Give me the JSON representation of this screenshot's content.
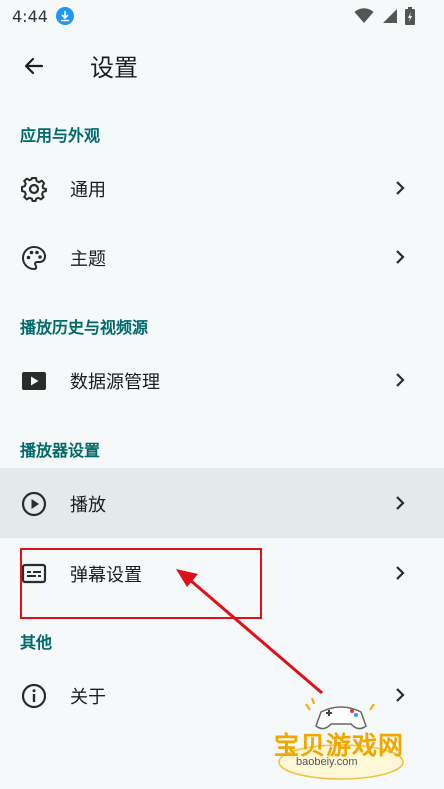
{
  "status_bar": {
    "time": "4:44"
  },
  "header": {
    "title": "设置"
  },
  "sections": [
    {
      "title": "应用与外观",
      "items": [
        {
          "label": "通用",
          "icon": "gear-icon"
        },
        {
          "label": "主题",
          "icon": "palette-icon"
        }
      ]
    },
    {
      "title": "播放历史与视频源",
      "items": [
        {
          "label": "数据源管理",
          "icon": "play-box-icon"
        }
      ]
    },
    {
      "title": "播放器设置",
      "items": [
        {
          "label": "播放",
          "icon": "play-circle-icon"
        },
        {
          "label": "弹幕设置",
          "icon": "subtitles-icon"
        }
      ]
    },
    {
      "title": "其他",
      "items": [
        {
          "label": "关于",
          "icon": "info-icon"
        }
      ]
    }
  ],
  "watermark": {
    "title": "宝贝游戏网",
    "url": "baobeiy.com"
  },
  "colors": {
    "background": "#f5f9fa",
    "section_header": "#006a6a",
    "active_row": "#e4e9eb",
    "annotation": "#e0101a",
    "watermark": "#f0a800"
  }
}
